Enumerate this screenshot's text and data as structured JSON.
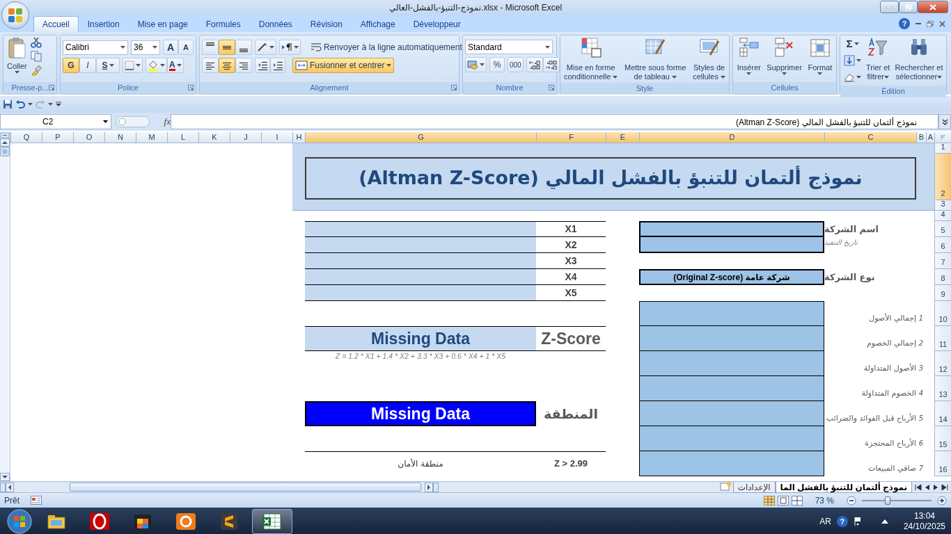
{
  "window": {
    "title": "نموذج-التنبؤ-بالفشل-العالي.xlsx - Microsoft Excel"
  },
  "ribbon_tabs": [
    {
      "label": "Accueil",
      "selected": true
    },
    {
      "label": "Insertion",
      "selected": false
    },
    {
      "label": "Mise en page",
      "selected": false
    },
    {
      "label": "Formules",
      "selected": false
    },
    {
      "label": "Données",
      "selected": false
    },
    {
      "label": "Révision",
      "selected": false
    },
    {
      "label": "Affichage",
      "selected": false
    },
    {
      "label": "Développeur",
      "selected": false
    }
  ],
  "help": "?",
  "ribbon": {
    "clipboard": {
      "label": "Presse-p...",
      "paste": "Coller"
    },
    "font": {
      "label": "Police",
      "name": "Calibri",
      "size": "36",
      "grow": "A",
      "shrink": "A",
      "styles": [
        {
          "text": "G",
          "on": true
        },
        {
          "text": "I",
          "on": false
        },
        {
          "text": "S",
          "on": false
        }
      ],
      "font_color_label": "A"
    },
    "alignment": {
      "label": "Alignement",
      "vertical": [
        {
          "selected": false
        },
        {
          "selected": true
        },
        {
          "selected": false
        }
      ],
      "horizontal": [
        {
          "selected": false
        },
        {
          "selected": true
        },
        {
          "selected": false
        }
      ],
      "wrap": "Renvoyer à la ligne automatiquement",
      "merge": {
        "label": "Fusionner et centrer",
        "on": true
      }
    },
    "number": {
      "label": "Nombre",
      "format": "Standard",
      "percent": "%",
      "thousands": "000"
    },
    "styles": {
      "label": "Style",
      "buttons": [
        [
          "Mise en forme",
          "conditionnelle"
        ],
        [
          "Mettre sous forme",
          "de tableau"
        ],
        [
          "Styles de",
          "cellules"
        ]
      ]
    },
    "cells": {
      "label": "Cellules",
      "buttons": [
        "Insérer",
        "Supprimer",
        "Format"
      ]
    },
    "editing": {
      "label": "Édition",
      "sum": "Σ",
      "buttons": [
        [
          "Trier et",
          "filtrer"
        ],
        [
          "Rechercher et",
          "sélectionner"
        ]
      ]
    }
  },
  "formula_bar": {
    "name_box": "C2",
    "fx": "fx",
    "content": "نموذج ألتمان للتنبؤ بالفشل المالي (Altman Z-Score)"
  },
  "columns": [
    {
      "label": "Q",
      "selected": false
    },
    {
      "label": "P",
      "selected": false
    },
    {
      "label": "O",
      "selected": false
    },
    {
      "label": "N",
      "selected": false
    },
    {
      "label": "M",
      "selected": false
    },
    {
      "label": "L",
      "selected": false
    },
    {
      "label": "K",
      "selected": false
    },
    {
      "label": "J",
      "selected": false
    },
    {
      "label": "I",
      "selected": false
    },
    {
      "label": "H",
      "selected": false
    },
    {
      "label": "G",
      "selected": true
    },
    {
      "label": "F",
      "selected": true
    },
    {
      "label": "E",
      "selected": true
    },
    {
      "label": "D",
      "selected": true
    },
    {
      "label": "C",
      "selected": true
    },
    {
      "label": "B",
      "selected": false
    },
    {
      "label": "A",
      "selected": false
    }
  ],
  "rows": [
    {
      "label": "1",
      "selected": false
    },
    {
      "label": "2",
      "selected": true
    },
    {
      "label": "3",
      "selected": false
    },
    {
      "label": "4",
      "selected": false
    },
    {
      "label": "5",
      "selected": false
    },
    {
      "label": "6",
      "selected": false
    },
    {
      "label": "7",
      "selected": false
    },
    {
      "label": "8",
      "selected": false
    },
    {
      "label": "9",
      "selected": false
    },
    {
      "label": "10",
      "selected": false
    },
    {
      "label": "11",
      "selected": false
    },
    {
      "label": "12",
      "selected": false
    },
    {
      "label": "13",
      "selected": false
    },
    {
      "label": "14",
      "selected": false
    },
    {
      "label": "15",
      "selected": false
    },
    {
      "label": "16",
      "selected": false
    }
  ],
  "sheet": {
    "title": "نموذج ألتمان للتنبؤ بالفشل المالي (Altman Z-Score)",
    "company": [
      {
        "label": "اسم الشركة",
        "kind": "main"
      },
      {
        "label": "تاريخ التنفيذ",
        "kind": "note"
      }
    ],
    "company_type": {
      "label": "نوع الشركة",
      "value": "شركة عامة (Original Z-score)"
    },
    "financials": [
      {
        "number": "1",
        "label": "إجمالي الأصول"
      },
      {
        "number": "2",
        "label": "إجمالي الخصوم"
      },
      {
        "number": "3",
        "label": "الأصول المتداولة"
      },
      {
        "number": "4",
        "label": "الخصوم المتداولة"
      },
      {
        "number": "5",
        "label": "الأرباح قبل الفوائد والضرائب"
      },
      {
        "number": "6",
        "label": "الأرباح المحتجزة"
      },
      {
        "number": "7",
        "label": "صافي المبيعات"
      }
    ],
    "ratios": [
      "X1",
      "X2",
      "X3",
      "X4",
      "X5"
    ],
    "z_score": {
      "label": "Z-Score",
      "value": "Missing Data",
      "formula": "Z = 1.2 * X1 + 1.4 * X2 + 3.3 * X3 + 0.6 * X4 + 1 * X5"
    },
    "zone": {
      "label": "المنطقة",
      "value": "Missing Data"
    },
    "zones": [
      {
        "label": "منطقة الأمان",
        "condition": "Z > 2.99"
      }
    ]
  },
  "sheet_tabs": [
    {
      "label": "نموذج ألتمان للتنبؤ بالفشل الما",
      "selected": true
    },
    {
      "label": "الإعدادات",
      "selected": false
    }
  ],
  "status_bar": {
    "text": "Prêt",
    "zoom": "73 %",
    "zoom_slider": {
      "level": 0.36
    }
  },
  "taskbar": {
    "apps": [
      {
        "selected": false
      },
      {
        "selected": false
      },
      {
        "selected": false
      },
      {
        "selected": false
      },
      {
        "selected": false
      },
      {
        "selected": true
      }
    ],
    "language": "AR",
    "help": "?",
    "time": "13:04",
    "date": "24/10/2025"
  }
}
